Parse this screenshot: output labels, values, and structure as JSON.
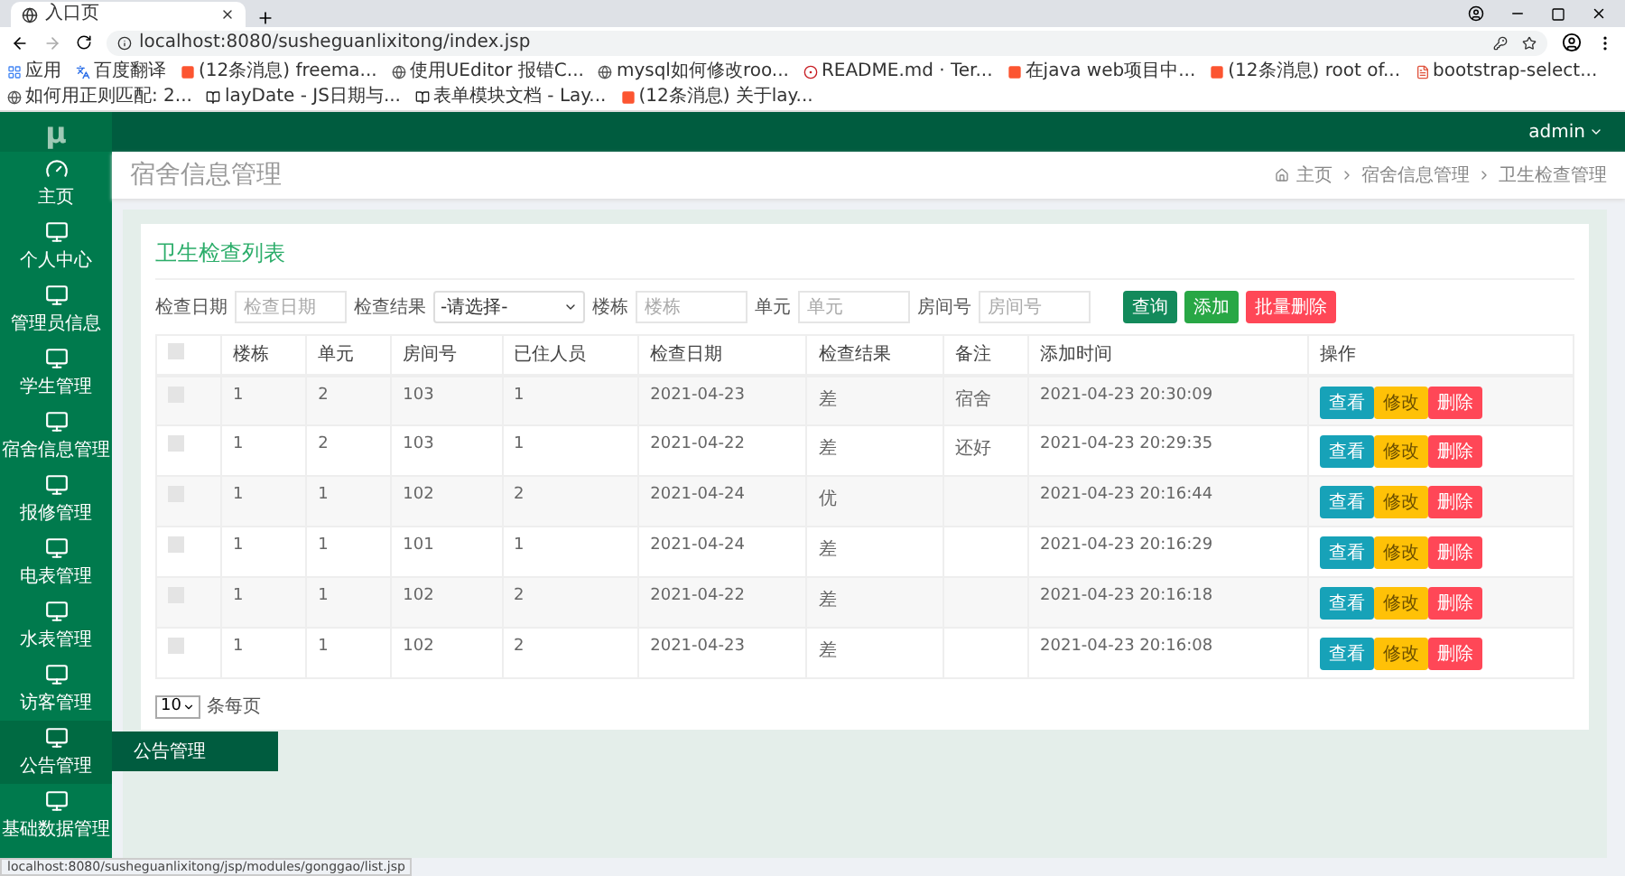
{
  "browser": {
    "tab_title": "入口页",
    "url": "localhost:8080/susheguanlixitong/index.jsp",
    "bookmarks": [
      {
        "label": "应用",
        "kind": "apps"
      },
      {
        "label": "百度翻译",
        "kind": "translate"
      },
      {
        "label": "(12条消息) freema...",
        "kind": "csdn"
      },
      {
        "label": "使用UEditor 报错C...",
        "kind": "page"
      },
      {
        "label": "mysql如何修改roo...",
        "kind": "page"
      },
      {
        "label": "README.md · Ter...",
        "kind": "gitee"
      },
      {
        "label": "在java web项目中...",
        "kind": "csdn"
      },
      {
        "label": "(12条消息) root of...",
        "kind": "csdn"
      },
      {
        "label": "bootstrap-select...",
        "kind": "doc"
      },
      {
        "label": "如何用正则匹配: 2...",
        "kind": "page"
      },
      {
        "label": "layDate - JS日期与...",
        "kind": "layui"
      },
      {
        "label": "表单模块文档 - Lay...",
        "kind": "layui"
      },
      {
        "label": "(12条消息) 关于lay...",
        "kind": "csdn"
      }
    ],
    "status_url": "localhost:8080/susheguanlixitong/jsp/modules/gonggao/list.jsp"
  },
  "app": {
    "logo": "μ",
    "user": "admin",
    "sidebar": [
      {
        "label": "主页",
        "kind": "dashboard",
        "hovered": false
      },
      {
        "label": "个人中心",
        "kind": "monitor",
        "hovered": false
      },
      {
        "label": "管理员信息",
        "kind": "monitor",
        "hovered": false
      },
      {
        "label": "学生管理",
        "kind": "monitor",
        "hovered": false
      },
      {
        "label": "宿舍信息管理",
        "kind": "monitor",
        "hovered": false
      },
      {
        "label": "报修管理",
        "kind": "monitor",
        "hovered": false
      },
      {
        "label": "电表管理",
        "kind": "monitor",
        "hovered": false
      },
      {
        "label": "水表管理",
        "kind": "monitor",
        "hovered": false
      },
      {
        "label": "访客管理",
        "kind": "monitor",
        "hovered": false
      },
      {
        "label": "公告管理",
        "kind": "monitor",
        "hovered": true,
        "flyout": "公告管理"
      },
      {
        "label": "基础数据管理",
        "kind": "monitor",
        "hovered": false
      }
    ],
    "page_title": "宿舍信息管理",
    "breadcrumb": [
      "主页",
      "宿舍信息管理",
      "卫生检查管理"
    ],
    "card_title": "卫生检查列表",
    "filters": [
      {
        "label": "检查日期",
        "kind": "input",
        "placeholder": "检查日期"
      },
      {
        "label": "检查结果",
        "kind": "select",
        "value": "-请选择-"
      },
      {
        "label": "楼栋",
        "kind": "input",
        "placeholder": "楼栋"
      },
      {
        "label": "单元",
        "kind": "input",
        "placeholder": "单元"
      },
      {
        "label": "房间号",
        "kind": "input",
        "placeholder": "房间号"
      }
    ],
    "buttons": [
      {
        "label": "查询",
        "kind": "query"
      },
      {
        "label": "添加",
        "kind": "add"
      },
      {
        "label": "批量删除",
        "kind": "delete"
      }
    ],
    "select_all_checked": false,
    "columns": [
      "楼栋",
      "单元",
      "房间号",
      "已住人员",
      "检查日期",
      "检查结果",
      "备注",
      "添加时间",
      "操作"
    ],
    "rows": [
      {
        "checked": false,
        "cells": [
          "1",
          "2",
          "103",
          "1",
          "2021-04-23",
          "差",
          "宿舍",
          "2021-04-23 20:30:09"
        ],
        "actions": [
          {
            "label": "查看",
            "kind": "view"
          },
          {
            "label": "修改",
            "kind": "edit"
          },
          {
            "label": "删除",
            "kind": "delete"
          }
        ]
      },
      {
        "checked": false,
        "cells": [
          "1",
          "2",
          "103",
          "1",
          "2021-04-22",
          "差",
          "还好",
          "2021-04-23 20:29:35"
        ],
        "actions": [
          {
            "label": "查看",
            "kind": "view"
          },
          {
            "label": "修改",
            "kind": "edit"
          },
          {
            "label": "删除",
            "kind": "delete"
          }
        ]
      },
      {
        "checked": false,
        "cells": [
          "1",
          "1",
          "102",
          "2",
          "2021-04-24",
          "优",
          "",
          "2021-04-23 20:16:44"
        ],
        "actions": [
          {
            "label": "查看",
            "kind": "view"
          },
          {
            "label": "修改",
            "kind": "edit"
          },
          {
            "label": "删除",
            "kind": "delete"
          }
        ]
      },
      {
        "checked": false,
        "cells": [
          "1",
          "1",
          "101",
          "1",
          "2021-04-24",
          "差",
          "",
          "2021-04-23 20:16:29"
        ],
        "actions": [
          {
            "label": "查看",
            "kind": "view"
          },
          {
            "label": "修改",
            "kind": "edit"
          },
          {
            "label": "删除",
            "kind": "delete"
          }
        ]
      },
      {
        "checked": false,
        "cells": [
          "1",
          "1",
          "102",
          "2",
          "2021-04-22",
          "差",
          "",
          "2021-04-23 20:16:18"
        ],
        "actions": [
          {
            "label": "查看",
            "kind": "view"
          },
          {
            "label": "修改",
            "kind": "edit"
          },
          {
            "label": "删除",
            "kind": "delete"
          }
        ]
      },
      {
        "checked": false,
        "cells": [
          "1",
          "1",
          "102",
          "2",
          "2021-04-23",
          "差",
          "",
          "2021-04-23 20:16:08"
        ],
        "actions": [
          {
            "label": "查看",
            "kind": "view"
          },
          {
            "label": "修改",
            "kind": "edit"
          },
          {
            "label": "删除",
            "kind": "delete"
          }
        ]
      }
    ],
    "pager": {
      "page_size": "10",
      "suffix": "条每页"
    }
  }
}
